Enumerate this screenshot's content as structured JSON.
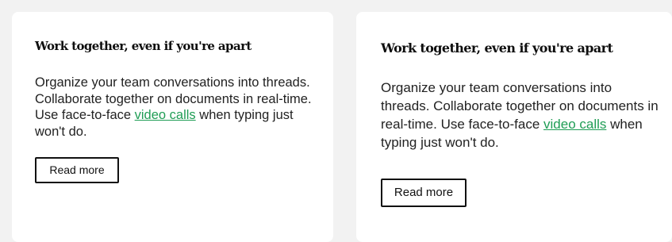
{
  "cards": [
    {
      "title": "Work together, even if you're apart",
      "body_before_link": "Organize your team conversations into threads. Collaborate together on documents in real-time. Use face-to-face ",
      "link_text": "video calls",
      "body_after_link": " when typing just won't do.",
      "button_label": "Read more"
    },
    {
      "title": "Work together, even if you're apart",
      "body_before_link": "Organize your team conversations into threads. Collaborate together on documents in real-time. Use face-to-face ",
      "link_text": "video calls",
      "body_after_link": " when typing just won't do.",
      "button_label": "Read more"
    }
  ],
  "colors": {
    "page_background": "#f2f2f2",
    "card_background": "#ffffff",
    "link": "#1f9d55",
    "text": "#222222"
  }
}
